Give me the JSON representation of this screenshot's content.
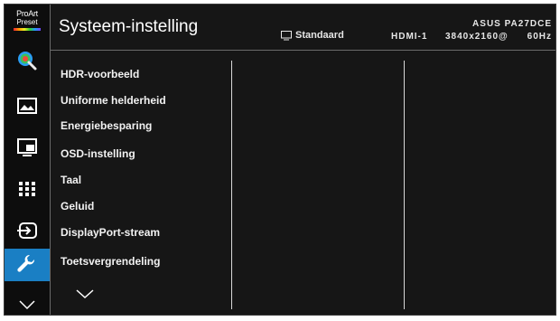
{
  "logo": {
    "line1": "ProArt",
    "line2": "Preset"
  },
  "sidebar": {
    "items": [
      {
        "icon": "palette-icon"
      },
      {
        "icon": "image-icon"
      },
      {
        "icon": "pip-icon"
      },
      {
        "icon": "grid-icon"
      },
      {
        "icon": "input-icon"
      },
      {
        "icon": "wrench-icon",
        "active": true
      },
      {
        "icon": "chevron-down-icon"
      }
    ],
    "active_color": "#1a7fc4"
  },
  "header": {
    "title": "Systeem-instelling",
    "mode": "Standaard",
    "input": "HDMI-1",
    "model": "ASUS PA27DCE",
    "resolution": "3840x2160@",
    "refresh": "60Hz"
  },
  "menu": {
    "items": [
      "HDR-voorbeeld",
      "Uniforme helderheid",
      "Energiebesparing",
      "OSD-instelling",
      "Taal",
      "Geluid",
      "DisplayPort-stream",
      "Toetsvergrendeling"
    ]
  }
}
